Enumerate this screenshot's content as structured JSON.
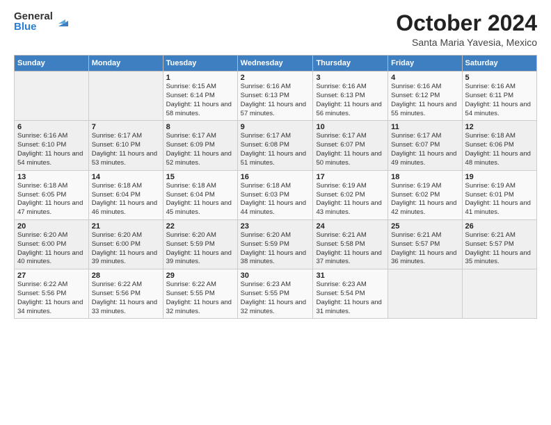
{
  "logo": {
    "general": "General",
    "blue": "Blue"
  },
  "header": {
    "month": "October 2024",
    "location": "Santa Maria Yavesia, Mexico"
  },
  "weekdays": [
    "Sunday",
    "Monday",
    "Tuesday",
    "Wednesday",
    "Thursday",
    "Friday",
    "Saturday"
  ],
  "weeks": [
    [
      {
        "day": "",
        "info": ""
      },
      {
        "day": "",
        "info": ""
      },
      {
        "day": "1",
        "info": "Sunrise: 6:15 AM\nSunset: 6:14 PM\nDaylight: 11 hours and 58 minutes."
      },
      {
        "day": "2",
        "info": "Sunrise: 6:16 AM\nSunset: 6:13 PM\nDaylight: 11 hours and 57 minutes."
      },
      {
        "day": "3",
        "info": "Sunrise: 6:16 AM\nSunset: 6:13 PM\nDaylight: 11 hours and 56 minutes."
      },
      {
        "day": "4",
        "info": "Sunrise: 6:16 AM\nSunset: 6:12 PM\nDaylight: 11 hours and 55 minutes."
      },
      {
        "day": "5",
        "info": "Sunrise: 6:16 AM\nSunset: 6:11 PM\nDaylight: 11 hours and 54 minutes."
      }
    ],
    [
      {
        "day": "6",
        "info": "Sunrise: 6:16 AM\nSunset: 6:10 PM\nDaylight: 11 hours and 54 minutes."
      },
      {
        "day": "7",
        "info": "Sunrise: 6:17 AM\nSunset: 6:10 PM\nDaylight: 11 hours and 53 minutes."
      },
      {
        "day": "8",
        "info": "Sunrise: 6:17 AM\nSunset: 6:09 PM\nDaylight: 11 hours and 52 minutes."
      },
      {
        "day": "9",
        "info": "Sunrise: 6:17 AM\nSunset: 6:08 PM\nDaylight: 11 hours and 51 minutes."
      },
      {
        "day": "10",
        "info": "Sunrise: 6:17 AM\nSunset: 6:07 PM\nDaylight: 11 hours and 50 minutes."
      },
      {
        "day": "11",
        "info": "Sunrise: 6:17 AM\nSunset: 6:07 PM\nDaylight: 11 hours and 49 minutes."
      },
      {
        "day": "12",
        "info": "Sunrise: 6:18 AM\nSunset: 6:06 PM\nDaylight: 11 hours and 48 minutes."
      }
    ],
    [
      {
        "day": "13",
        "info": "Sunrise: 6:18 AM\nSunset: 6:05 PM\nDaylight: 11 hours and 47 minutes."
      },
      {
        "day": "14",
        "info": "Sunrise: 6:18 AM\nSunset: 6:04 PM\nDaylight: 11 hours and 46 minutes."
      },
      {
        "day": "15",
        "info": "Sunrise: 6:18 AM\nSunset: 6:04 PM\nDaylight: 11 hours and 45 minutes."
      },
      {
        "day": "16",
        "info": "Sunrise: 6:18 AM\nSunset: 6:03 PM\nDaylight: 11 hours and 44 minutes."
      },
      {
        "day": "17",
        "info": "Sunrise: 6:19 AM\nSunset: 6:02 PM\nDaylight: 11 hours and 43 minutes."
      },
      {
        "day": "18",
        "info": "Sunrise: 6:19 AM\nSunset: 6:02 PM\nDaylight: 11 hours and 42 minutes."
      },
      {
        "day": "19",
        "info": "Sunrise: 6:19 AM\nSunset: 6:01 PM\nDaylight: 11 hours and 41 minutes."
      }
    ],
    [
      {
        "day": "20",
        "info": "Sunrise: 6:20 AM\nSunset: 6:00 PM\nDaylight: 11 hours and 40 minutes."
      },
      {
        "day": "21",
        "info": "Sunrise: 6:20 AM\nSunset: 6:00 PM\nDaylight: 11 hours and 39 minutes."
      },
      {
        "day": "22",
        "info": "Sunrise: 6:20 AM\nSunset: 5:59 PM\nDaylight: 11 hours and 39 minutes."
      },
      {
        "day": "23",
        "info": "Sunrise: 6:20 AM\nSunset: 5:59 PM\nDaylight: 11 hours and 38 minutes."
      },
      {
        "day": "24",
        "info": "Sunrise: 6:21 AM\nSunset: 5:58 PM\nDaylight: 11 hours and 37 minutes."
      },
      {
        "day": "25",
        "info": "Sunrise: 6:21 AM\nSunset: 5:57 PM\nDaylight: 11 hours and 36 minutes."
      },
      {
        "day": "26",
        "info": "Sunrise: 6:21 AM\nSunset: 5:57 PM\nDaylight: 11 hours and 35 minutes."
      }
    ],
    [
      {
        "day": "27",
        "info": "Sunrise: 6:22 AM\nSunset: 5:56 PM\nDaylight: 11 hours and 34 minutes."
      },
      {
        "day": "28",
        "info": "Sunrise: 6:22 AM\nSunset: 5:56 PM\nDaylight: 11 hours and 33 minutes."
      },
      {
        "day": "29",
        "info": "Sunrise: 6:22 AM\nSunset: 5:55 PM\nDaylight: 11 hours and 32 minutes."
      },
      {
        "day": "30",
        "info": "Sunrise: 6:23 AM\nSunset: 5:55 PM\nDaylight: 11 hours and 32 minutes."
      },
      {
        "day": "31",
        "info": "Sunrise: 6:23 AM\nSunset: 5:54 PM\nDaylight: 11 hours and 31 minutes."
      },
      {
        "day": "",
        "info": ""
      },
      {
        "day": "",
        "info": ""
      }
    ]
  ]
}
